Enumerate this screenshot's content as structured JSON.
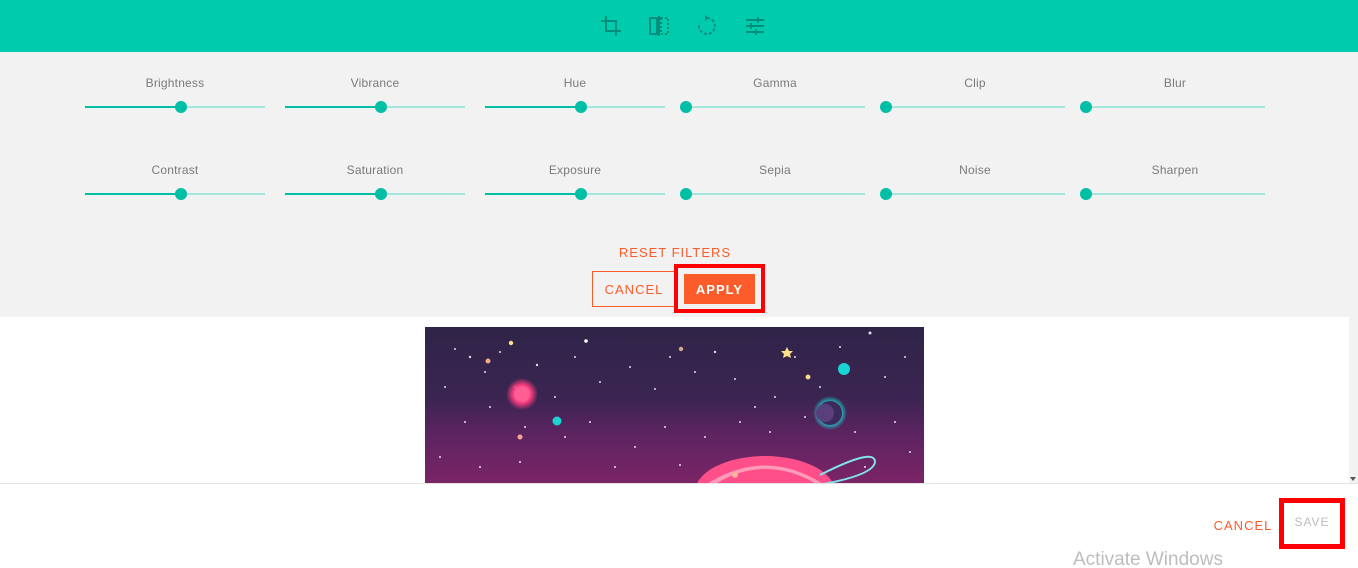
{
  "toolbar": {
    "tools": [
      {
        "icon": "crop-icon"
      },
      {
        "icon": "flip-icon"
      },
      {
        "icon": "rotate-icon"
      },
      {
        "icon": "filters-icon"
      }
    ],
    "background": "#00cbad"
  },
  "filters": {
    "row1": [
      {
        "label": "Brightness",
        "value": 0.53
      },
      {
        "label": "Vibrance",
        "value": 0.53
      },
      {
        "label": "Hue",
        "value": 0.53
      },
      {
        "label": "Gamma",
        "value": 0.0
      },
      {
        "label": "Clip",
        "value": 0.0
      },
      {
        "label": "Blur",
        "value": 0.0
      }
    ],
    "row2": [
      {
        "label": "Contrast",
        "value": 0.53
      },
      {
        "label": "Saturation",
        "value": 0.53
      },
      {
        "label": "Exposure",
        "value": 0.53
      },
      {
        "label": "Sepia",
        "value": 0.0
      },
      {
        "label": "Noise",
        "value": 0.0
      },
      {
        "label": "Sharpen",
        "value": 0.0
      }
    ],
    "reset_label": "RESET FILTERS",
    "cancel_label": "CANCEL",
    "apply_label": "APPLY"
  },
  "footer": {
    "cancel_label": "CANCEL",
    "save_label": "SAVE",
    "watermark": "Activate Windows"
  },
  "colors": {
    "accent": "#00bfa5",
    "action": "#fc5b2a",
    "highlight": "#ff0000"
  }
}
